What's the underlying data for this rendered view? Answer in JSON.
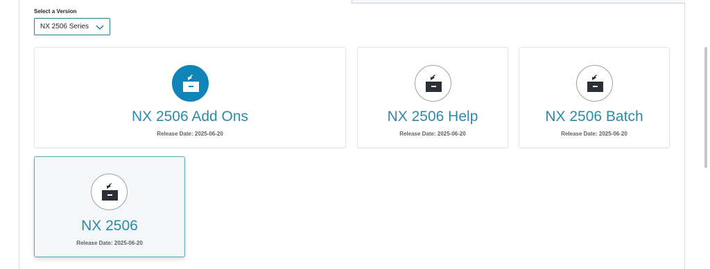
{
  "version_selector": {
    "label": "Select a Version",
    "selected": "NX 2506 Series"
  },
  "cards": [
    {
      "title": "NX 2506 Add Ons",
      "release_date": "Release Date: 2025-06-20",
      "icon": "download-box-icon",
      "icon_style": "filled"
    },
    {
      "title": "NX 2506 Help",
      "release_date": "Release Date: 2025-06-20",
      "icon": "download-box-icon",
      "icon_style": "outline"
    },
    {
      "title": "NX 2506 Batch",
      "release_date": "Release Date: 2025-06-20",
      "icon": "download-box-icon",
      "icon_style": "outline"
    },
    {
      "title": "NX 2506",
      "release_date": "Release Date: 2025-06-20",
      "icon": "download-box-icon",
      "icon_style": "outline",
      "state": "hovered"
    }
  ],
  "colors": {
    "accent": "#2c8aa8",
    "icon_fill": "#0f84b6",
    "select_border": "#2d7b95",
    "active_border": "#5aa7c4"
  }
}
